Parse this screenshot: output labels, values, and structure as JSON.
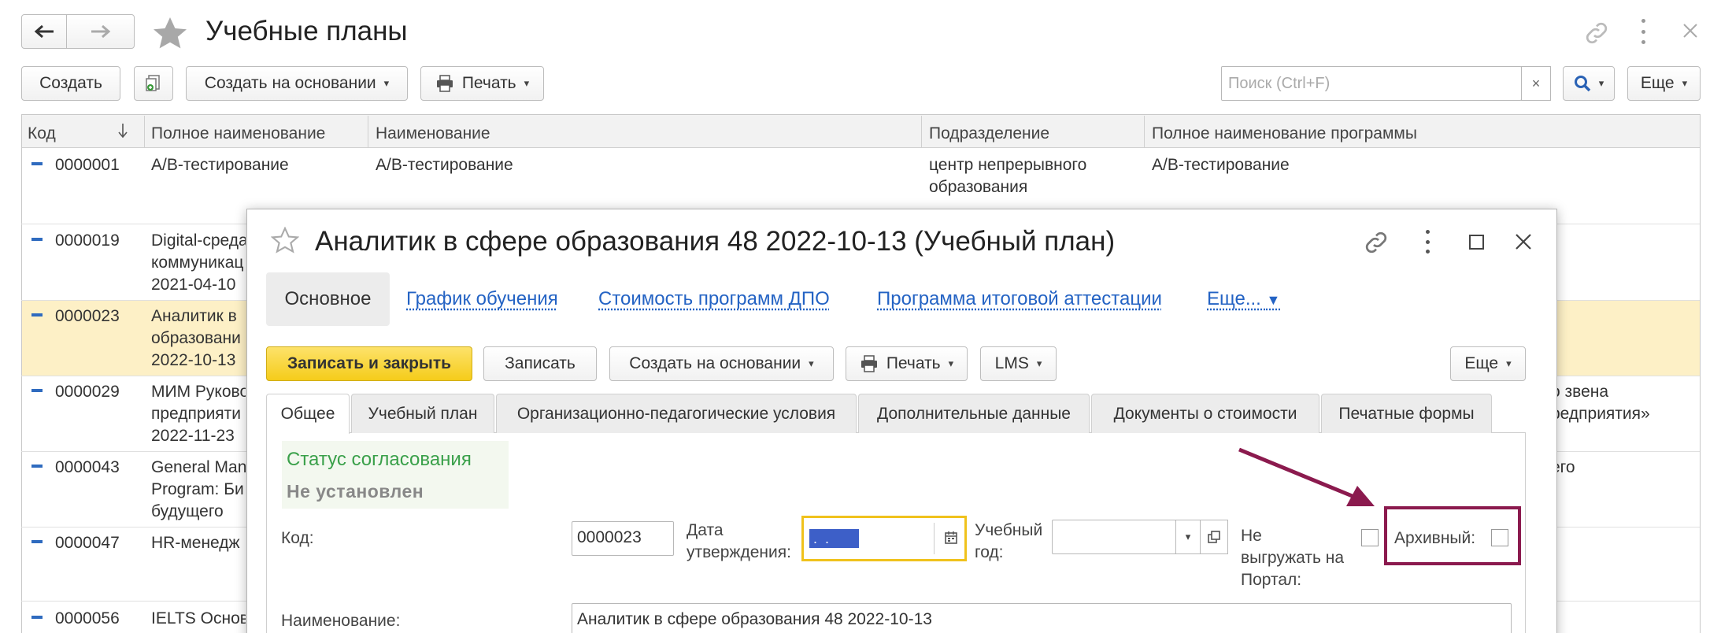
{
  "window": {
    "title": "Учебные планы",
    "toolbar": {
      "create": "Создать",
      "create_based": "Создать на основании",
      "print": "Печать",
      "search_placeholder": "Поиск (Ctrl+F)",
      "more": "Еще"
    }
  },
  "table": {
    "columns": [
      "Код",
      "Полное наименование",
      "Наименование",
      "Подразделение",
      "Полное наименование программы"
    ],
    "rows": [
      {
        "code": "0000001",
        "full": [
          "А/В-тестирование"
        ],
        "name": "А/В-тестирование",
        "dept": [
          "центр непрерывного",
          "образования"
        ],
        "prog": [
          "А/В-тестирование"
        ],
        "selected": false
      },
      {
        "code": "0000019",
        "full": [
          "Digital-среда",
          "коммуникац",
          "2021-04-10"
        ],
        "name": "",
        "dept": [],
        "prog": [],
        "selected": false
      },
      {
        "code": "0000023",
        "full": [
          "Аналитик в",
          "образовани",
          "2022-10-13"
        ],
        "name": "",
        "dept": [],
        "prog": [],
        "selected": true
      },
      {
        "code": "0000029",
        "full": [
          "МИМ Руково",
          "предприяти",
          "2022-11-23"
        ],
        "name": "",
        "dept": [],
        "prog": [
          "о звена",
          "редприятия»"
        ],
        "selected": false
      },
      {
        "code": "0000043",
        "full": [
          "General Man",
          "Program: Би",
          "будущего"
        ],
        "name": "",
        "dept": [],
        "prog": [
          "его"
        ],
        "selected": false
      },
      {
        "code": "0000047",
        "full": [
          "HR-менедж"
        ],
        "name": "",
        "dept": [],
        "prog": [],
        "selected": false
      },
      {
        "code": "0000056",
        "full": [
          "IELTS Основ"
        ],
        "name": "",
        "dept": [],
        "prog": [],
        "selected": false
      }
    ]
  },
  "dialog": {
    "title": "Аналитик в сфере образования 48 2022-10-13 (Учебный план)",
    "nav": {
      "main": "Основное",
      "links": [
        "График обучения",
        "Стоимость программ ДПО",
        "Программа итоговой аттестации"
      ],
      "more": "Еще..."
    },
    "toolbar": {
      "save_close": "Записать и закрыть",
      "save": "Записать",
      "create_based": "Создать на основании",
      "print": "Печать",
      "lms": "LMS",
      "more": "Еще"
    },
    "tabs": [
      "Общее",
      "Учебный план",
      "Организационно-педагогические условия",
      "Дополнительные данные",
      "Документы о стоимости",
      "Печатные формы"
    ],
    "status_title": "Статус согласования",
    "status_value": "Не установлен",
    "fields": {
      "code_label": "Код:",
      "code_value": "0000023",
      "date_label_1": "Дата",
      "date_label_2": "утверждения:",
      "date_value": " .  . ",
      "year_label_1": "Учебный",
      "year_label_2": "год:",
      "year_value": "",
      "portal_label_1": "Не",
      "portal_label_2": "выгружать на",
      "portal_label_3": "Портал:",
      "archive_label": "Архивный:",
      "name_label": "Наименование:",
      "name_value": "Аналитик в сфере образования 48 2022-10-13"
    }
  },
  "annotation": {
    "color": "#8b1a4e"
  }
}
